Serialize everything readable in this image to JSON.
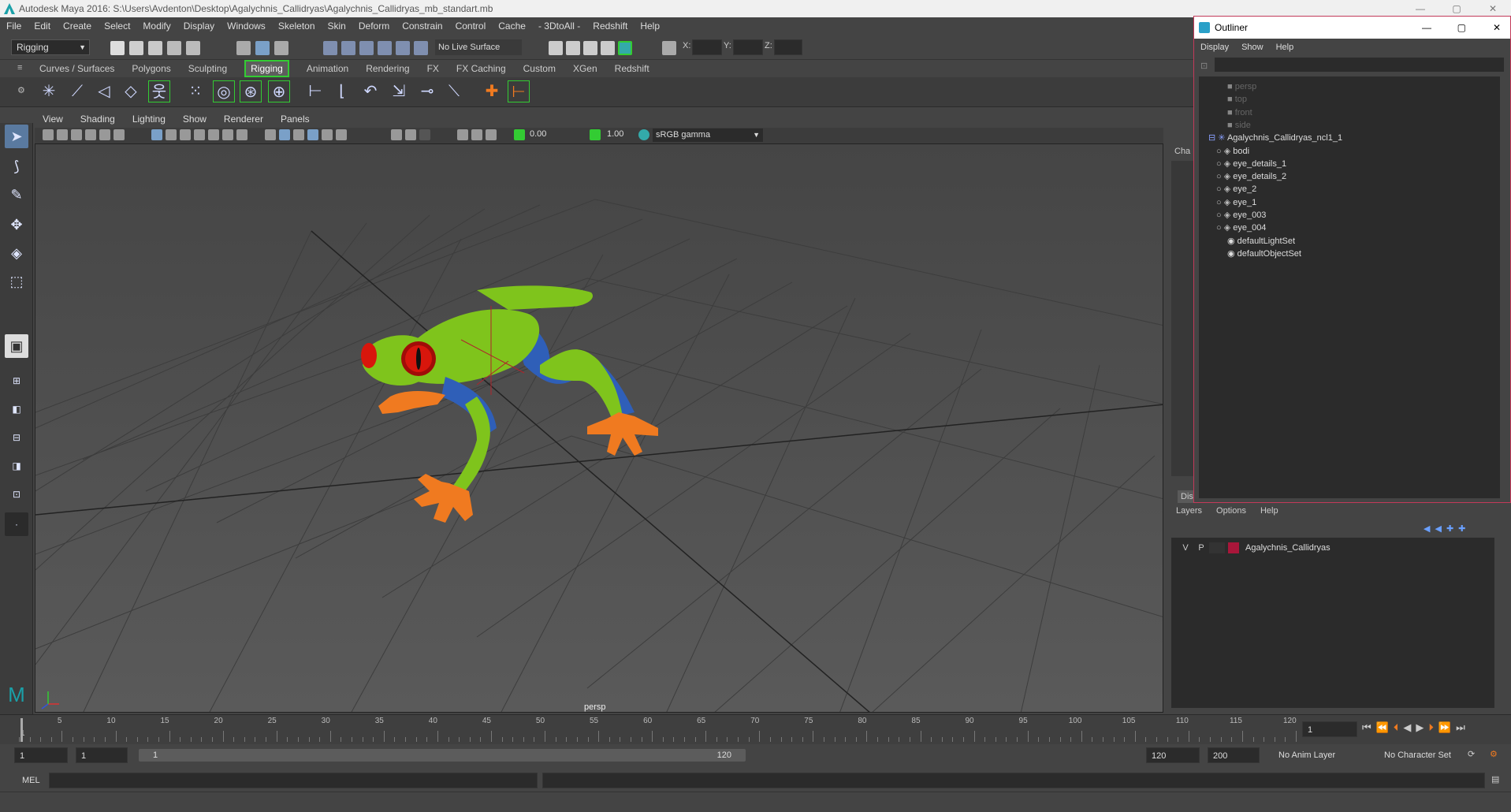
{
  "window": {
    "title": "Autodesk Maya 2016: S:\\Users\\Avdenton\\Desktop\\Agalychnis_Callidryas\\Agalychnis_Callidryas_mb_standart.mb",
    "min": "—",
    "max": "▢",
    "close": "✕"
  },
  "menubar": [
    "File",
    "Edit",
    "Create",
    "Select",
    "Modify",
    "Display",
    "Windows",
    "Skeleton",
    "Skin",
    "Deform",
    "Constrain",
    "Control",
    "Cache",
    "- 3DtoAll -",
    "Redshift",
    "Help"
  ],
  "statusline": {
    "menuset": "Rigging",
    "live_surface": "No Live Surface",
    "x_label": "X:",
    "y_label": "Y:",
    "z_label": "Z:"
  },
  "shelf_tabs": [
    {
      "label": "Curves / Surfaces",
      "active": false
    },
    {
      "label": "Polygons",
      "active": false
    },
    {
      "label": "Sculpting",
      "active": false
    },
    {
      "label": "Rigging",
      "active": true
    },
    {
      "label": "Animation",
      "active": false
    },
    {
      "label": "Rendering",
      "active": false
    },
    {
      "label": "FX",
      "active": false
    },
    {
      "label": "FX Caching",
      "active": false
    },
    {
      "label": "Custom",
      "active": false
    },
    {
      "label": "XGen",
      "active": false
    },
    {
      "label": "Redshift",
      "active": false
    }
  ],
  "viewport": {
    "menu": [
      "View",
      "Shading",
      "Lighting",
      "Show",
      "Renderer",
      "Panels"
    ],
    "exposure": "0.00",
    "gamma": "1.00",
    "colorspace": "sRGB gamma",
    "camera_label": "persp"
  },
  "outliner": {
    "title": "Outliner",
    "menu": [
      "Display",
      "Show",
      "Help"
    ],
    "items": [
      {
        "label": "persp",
        "dim": true,
        "indent": 2
      },
      {
        "label": "top",
        "dim": true,
        "indent": 2
      },
      {
        "label": "front",
        "dim": true,
        "indent": 2
      },
      {
        "label": "side",
        "dim": true,
        "indent": 2
      },
      {
        "label": "Agalychnis_Callidryas_ncl1_1",
        "dim": false,
        "indent": 1
      },
      {
        "label": "bodi",
        "dim": false,
        "indent": 3
      },
      {
        "label": "eye_details_1",
        "dim": false,
        "indent": 3
      },
      {
        "label": "eye_details_2",
        "dim": false,
        "indent": 3
      },
      {
        "label": "eye_2",
        "dim": false,
        "indent": 3
      },
      {
        "label": "eye_1",
        "dim": false,
        "indent": 3
      },
      {
        "label": "eye_003",
        "dim": false,
        "indent": 3
      },
      {
        "label": "eye_004",
        "dim": false,
        "indent": 3
      },
      {
        "label": "defaultLightSet",
        "dim": false,
        "indent": 2
      },
      {
        "label": "defaultObjectSet",
        "dim": false,
        "indent": 2
      }
    ]
  },
  "channel_box": {
    "tab": "Cha",
    "disp_tab": "Dis"
  },
  "layers": {
    "menu": [
      "Layers",
      "Options",
      "Help"
    ],
    "v": "V",
    "p": "P",
    "name": "Agalychnis_Callidryas",
    "color": "#a8163a"
  },
  "timeline": {
    "ticks": [
      "5",
      "10",
      "15",
      "20",
      "25",
      "30",
      "35",
      "40",
      "45",
      "50",
      "55",
      "60",
      "65",
      "70",
      "75",
      "80",
      "85",
      "90",
      "95",
      "100",
      "105",
      "110",
      "115",
      "120"
    ],
    "start_label": "1",
    "current_frame": "1"
  },
  "range": {
    "start": "1",
    "start2": "1",
    "slider_start": "1",
    "slider_end": "120",
    "end": "120",
    "end2": "200",
    "anim_layer": "No Anim Layer",
    "char_set": "No Character Set"
  },
  "cmdline": {
    "label": "MEL"
  },
  "colors": {
    "accent_green": "#33cc33",
    "outliner_border": "#c33a5a",
    "frog_green": "#7fc41c",
    "frog_orange": "#f07a20",
    "frog_blue": "#2f5fb8",
    "eye_red": "#d8160c"
  }
}
